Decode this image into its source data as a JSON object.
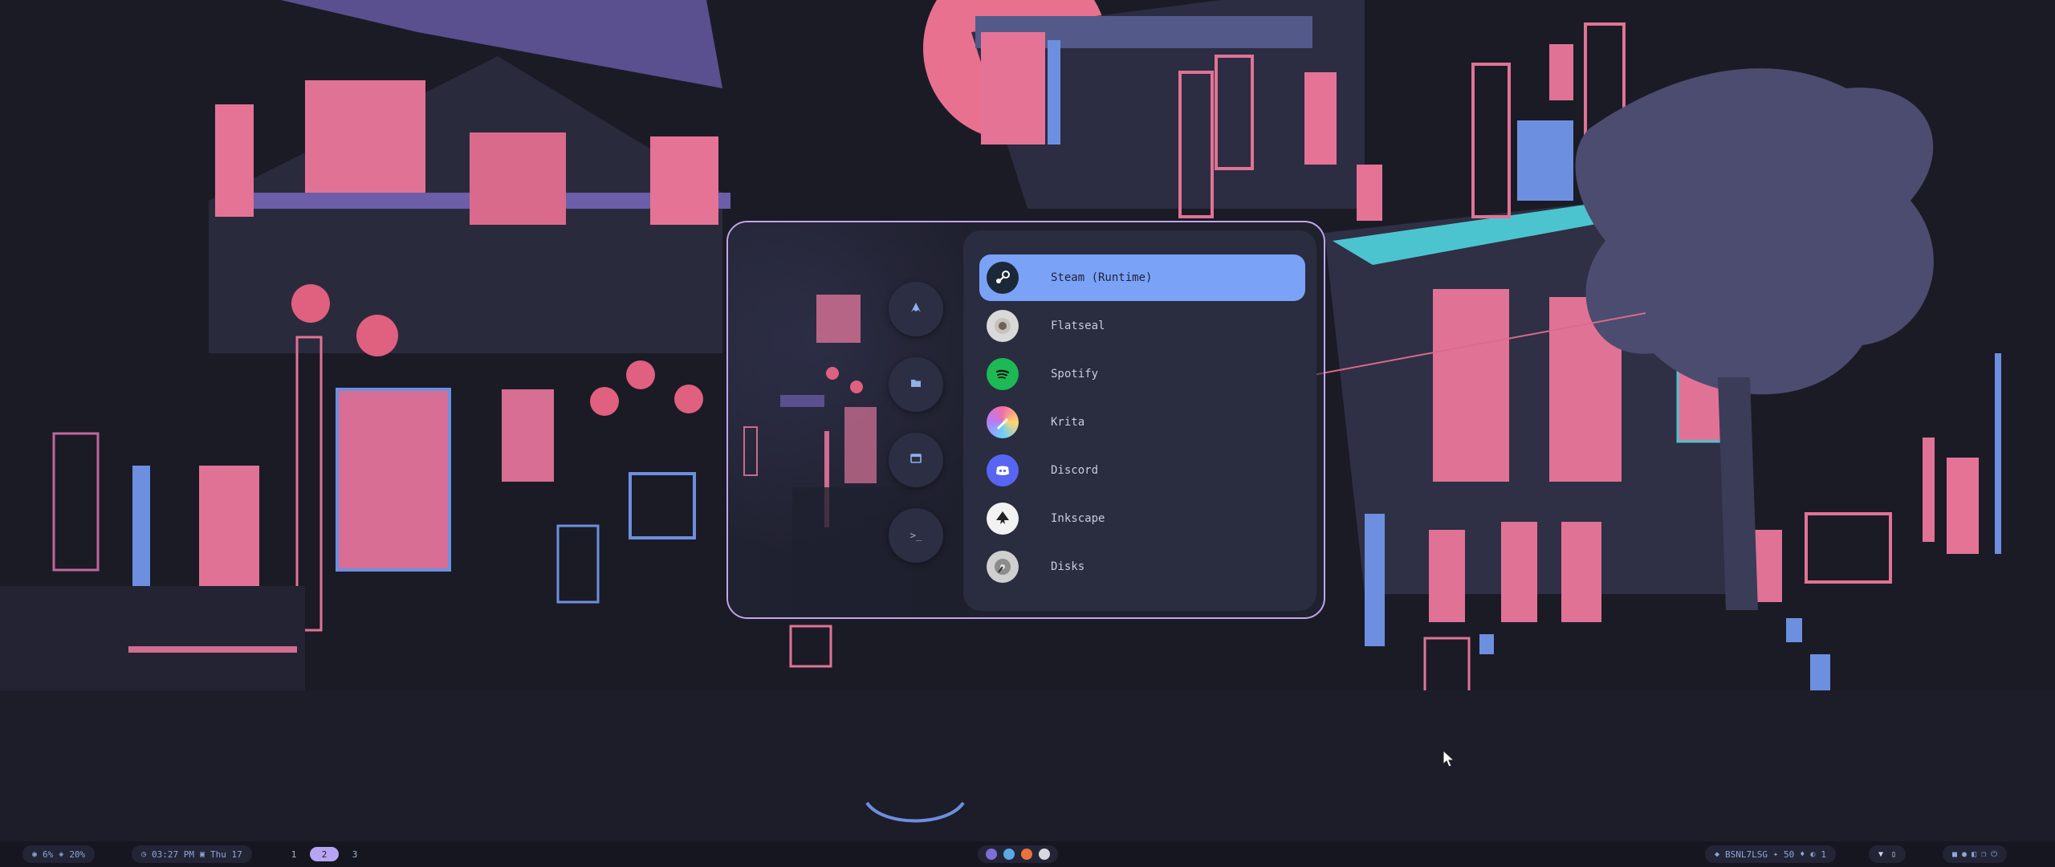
{
  "launcher": {
    "modes": [
      {
        "name": "apps",
        "icon": "arch-logo-icon"
      },
      {
        "name": "files",
        "icon": "folder-icon"
      },
      {
        "name": "windows",
        "icon": "window-icon"
      },
      {
        "name": "run",
        "icon": "terminal-icon",
        "glyph": ">_"
      }
    ],
    "apps": [
      {
        "label": "Steam (Runtime)",
        "icon": "steam-icon",
        "selected": true
      },
      {
        "label": "Flatseal",
        "icon": "flatseal-icon",
        "selected": false
      },
      {
        "label": "Spotify",
        "icon": "spotify-icon",
        "selected": false
      },
      {
        "label": "Krita",
        "icon": "krita-icon",
        "selected": false
      },
      {
        "label": "Discord",
        "icon": "discord-icon",
        "selected": false
      },
      {
        "label": "Inkscape",
        "icon": "inkscape-icon",
        "selected": false
      },
      {
        "label": "Disks",
        "icon": "disks-icon",
        "selected": false
      }
    ],
    "colors": {
      "border": "#c2a6ef",
      "selected": "#7aa2f7",
      "panel": "#2a2c3f"
    }
  },
  "bar": {
    "system": {
      "cpu": "6%",
      "memory": "20%"
    },
    "clock": {
      "time": "03:27 PM",
      "date": "Thu 17"
    },
    "workspaces": [
      {
        "label": "1",
        "active": false
      },
      {
        "label": "2",
        "active": true
      },
      {
        "label": "3",
        "active": false
      }
    ],
    "tray_icons": [
      "arch-icon",
      "telegram-icon",
      "firefox-icon",
      "github-icon"
    ],
    "network": {
      "ssid": "BSNL7LSG",
      "brightness": "50",
      "volume_icon": "volume-icon",
      "battery_level": "1"
    },
    "right_icons": [
      "notification-icon",
      "lock-icon",
      "settings-icon",
      "copy-icon",
      "power-icon"
    ],
    "accent": "#b7a4f2"
  }
}
